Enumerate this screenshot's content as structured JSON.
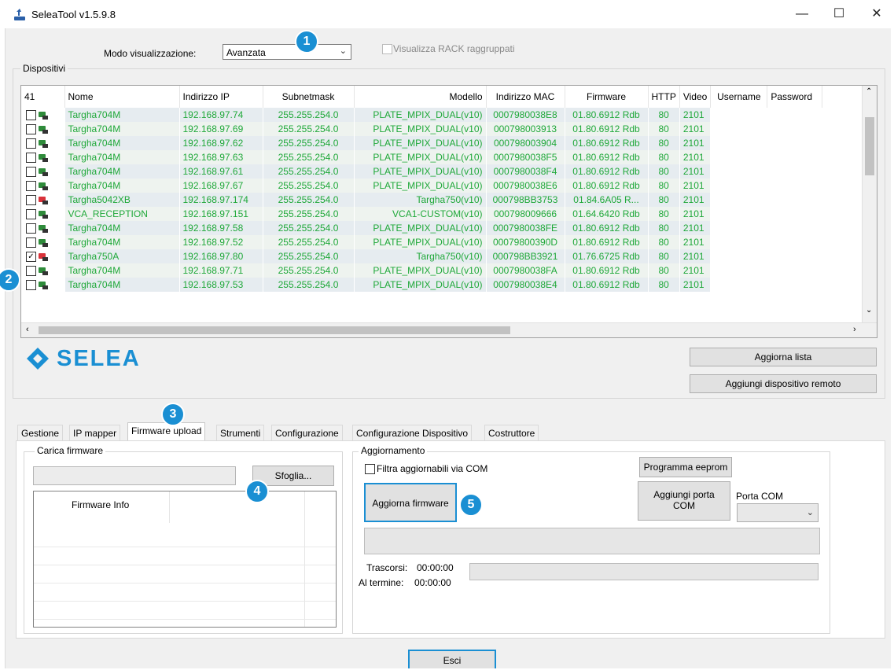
{
  "window": {
    "title": "SeleaTool v1.5.9.8",
    "minimize": "—",
    "maximize": "☐",
    "close": "✕"
  },
  "top": {
    "mode_label": "Modo visualizzazione:",
    "mode_value": "Avanzata",
    "rack_label": "Visualizza RACK raggruppati"
  },
  "devices_group": {
    "title": "Dispositivi"
  },
  "grid": {
    "columns": [
      "41",
      "Nome",
      "Indirizzo IP",
      "Subnetmask",
      "Modello",
      "Indirizzo MAC",
      "Firmware",
      "HTTP",
      "Video",
      "Username",
      "Password"
    ],
    "rows": [
      {
        "checked": false,
        "icon": "camera-green",
        "name": "Targha704M",
        "ip": "192.168.97.74",
        "mask": "255.255.254.0",
        "model": "PLATE_MPIX_DUAL(v10)",
        "mac": "0007980038E8",
        "fw": "01.80.6912 Rdb",
        "http": "80",
        "video": "2101"
      },
      {
        "checked": false,
        "icon": "camera-green",
        "name": "Targha704M",
        "ip": "192.168.97.69",
        "mask": "255.255.254.0",
        "model": "PLATE_MPIX_DUAL(v10)",
        "mac": "000798003913",
        "fw": "01.80.6912 Rdb",
        "http": "80",
        "video": "2101"
      },
      {
        "checked": false,
        "icon": "camera-green",
        "name": "Targha704M",
        "ip": "192.168.97.62",
        "mask": "255.255.254.0",
        "model": "PLATE_MPIX_DUAL(v10)",
        "mac": "000798003904",
        "fw": "01.80.6912 Rdb",
        "http": "80",
        "video": "2101"
      },
      {
        "checked": false,
        "icon": "camera-green",
        "name": "Targha704M",
        "ip": "192.168.97.63",
        "mask": "255.255.254.0",
        "model": "PLATE_MPIX_DUAL(v10)",
        "mac": "0007980038F5",
        "fw": "01.80.6912 Rdb",
        "http": "80",
        "video": "2101"
      },
      {
        "checked": false,
        "icon": "camera-green",
        "name": "Targha704M",
        "ip": "192.168.97.61",
        "mask": "255.255.254.0",
        "model": "PLATE_MPIX_DUAL(v10)",
        "mac": "0007980038F4",
        "fw": "01.80.6912 Rdb",
        "http": "80",
        "video": "2101"
      },
      {
        "checked": false,
        "icon": "camera-green",
        "name": "Targha704M",
        "ip": "192.168.97.67",
        "mask": "255.255.254.0",
        "model": "PLATE_MPIX_DUAL(v10)",
        "mac": "0007980038E6",
        "fw": "01.80.6912 Rdb",
        "http": "80",
        "video": "2101"
      },
      {
        "checked": false,
        "icon": "camera-red",
        "name": "Targha5042XB",
        "ip": "192.168.97.174",
        "mask": "255.255.254.0",
        "model": "Targha750(v10)",
        "mac": "000798BB3753",
        "fw": "01.84.6A05 R...",
        "http": "80",
        "video": "2101"
      },
      {
        "checked": false,
        "icon": "camera-green",
        "name": "VCA_RECEPTION",
        "ip": "192.168.97.151",
        "mask": "255.255.254.0",
        "model": "VCA1-CUSTOM(v10)",
        "mac": "000798009666",
        "fw": "01.64.6420 Rdb",
        "http": "80",
        "video": "2101"
      },
      {
        "checked": false,
        "icon": "camera-green",
        "name": "Targha704M",
        "ip": "192.168.97.58",
        "mask": "255.255.254.0",
        "model": "PLATE_MPIX_DUAL(v10)",
        "mac": "0007980038FE",
        "fw": "01.80.6912 Rdb",
        "http": "80",
        "video": "2101"
      },
      {
        "checked": false,
        "icon": "camera-green",
        "name": "Targha704M",
        "ip": "192.168.97.52",
        "mask": "255.255.254.0",
        "model": "PLATE_MPIX_DUAL(v10)",
        "mac": "00079800390D",
        "fw": "01.80.6912 Rdb",
        "http": "80",
        "video": "2101"
      },
      {
        "checked": true,
        "icon": "camera-red",
        "name": "Targha750A",
        "ip": "192.168.97.80",
        "mask": "255.255.254.0",
        "model": "Targha750(v10)",
        "mac": "000798BB3921",
        "fw": "01.76.6725 Rdb",
        "http": "80",
        "video": "2101"
      },
      {
        "checked": false,
        "icon": "camera-green",
        "name": "Targha704M",
        "ip": "192.168.97.71",
        "mask": "255.255.254.0",
        "model": "PLATE_MPIX_DUAL(v10)",
        "mac": "0007980038FA",
        "fw": "01.80.6912 Rdb",
        "http": "80",
        "video": "2101"
      },
      {
        "checked": false,
        "icon": "camera-green",
        "name": "Targha704M",
        "ip": "192.168.97.53",
        "mask": "255.255.254.0",
        "model": "PLATE_MPIX_DUAL(v10)",
        "mac": "0007980038E4",
        "fw": "01.80.6912 Rdb",
        "http": "80",
        "video": "2101"
      }
    ]
  },
  "logo": {
    "text": "SELEA",
    "color": "#1a8fd3"
  },
  "buttons": {
    "refresh": "Aggiorna lista",
    "add_remote": "Aggiungi dispositivo remoto",
    "browse": "Sfoglia...",
    "program_eeprom": "Programma eeprom",
    "update_fw": "Aggiorna firmware",
    "add_com_1": "Aggiungi porta",
    "add_com_2": "COM",
    "exit": "Esci"
  },
  "tabs": [
    "Gestione",
    "IP mapper",
    "Firmware upload",
    "Strumenti",
    "Configurazione",
    "Configurazione Dispositivo",
    "Costruttore"
  ],
  "active_tab": "Firmware upload",
  "firmware_panel": {
    "title": "Carica firmware",
    "column": "Firmware Info"
  },
  "update_panel": {
    "title": "Aggiornamento",
    "filter_label": "Filtra aggiornabili via COM",
    "port_label": "Porta COM",
    "elapsed_label": "Trascorsi:",
    "elapsed_value": "00:00:00",
    "remaining_label": "Al termine:",
    "remaining_value": "00:00:00"
  },
  "callouts": [
    "1",
    "2",
    "3",
    "4",
    "5"
  ],
  "colors": {
    "accent": "#1a8fd3",
    "row_text": "#1fa839"
  }
}
